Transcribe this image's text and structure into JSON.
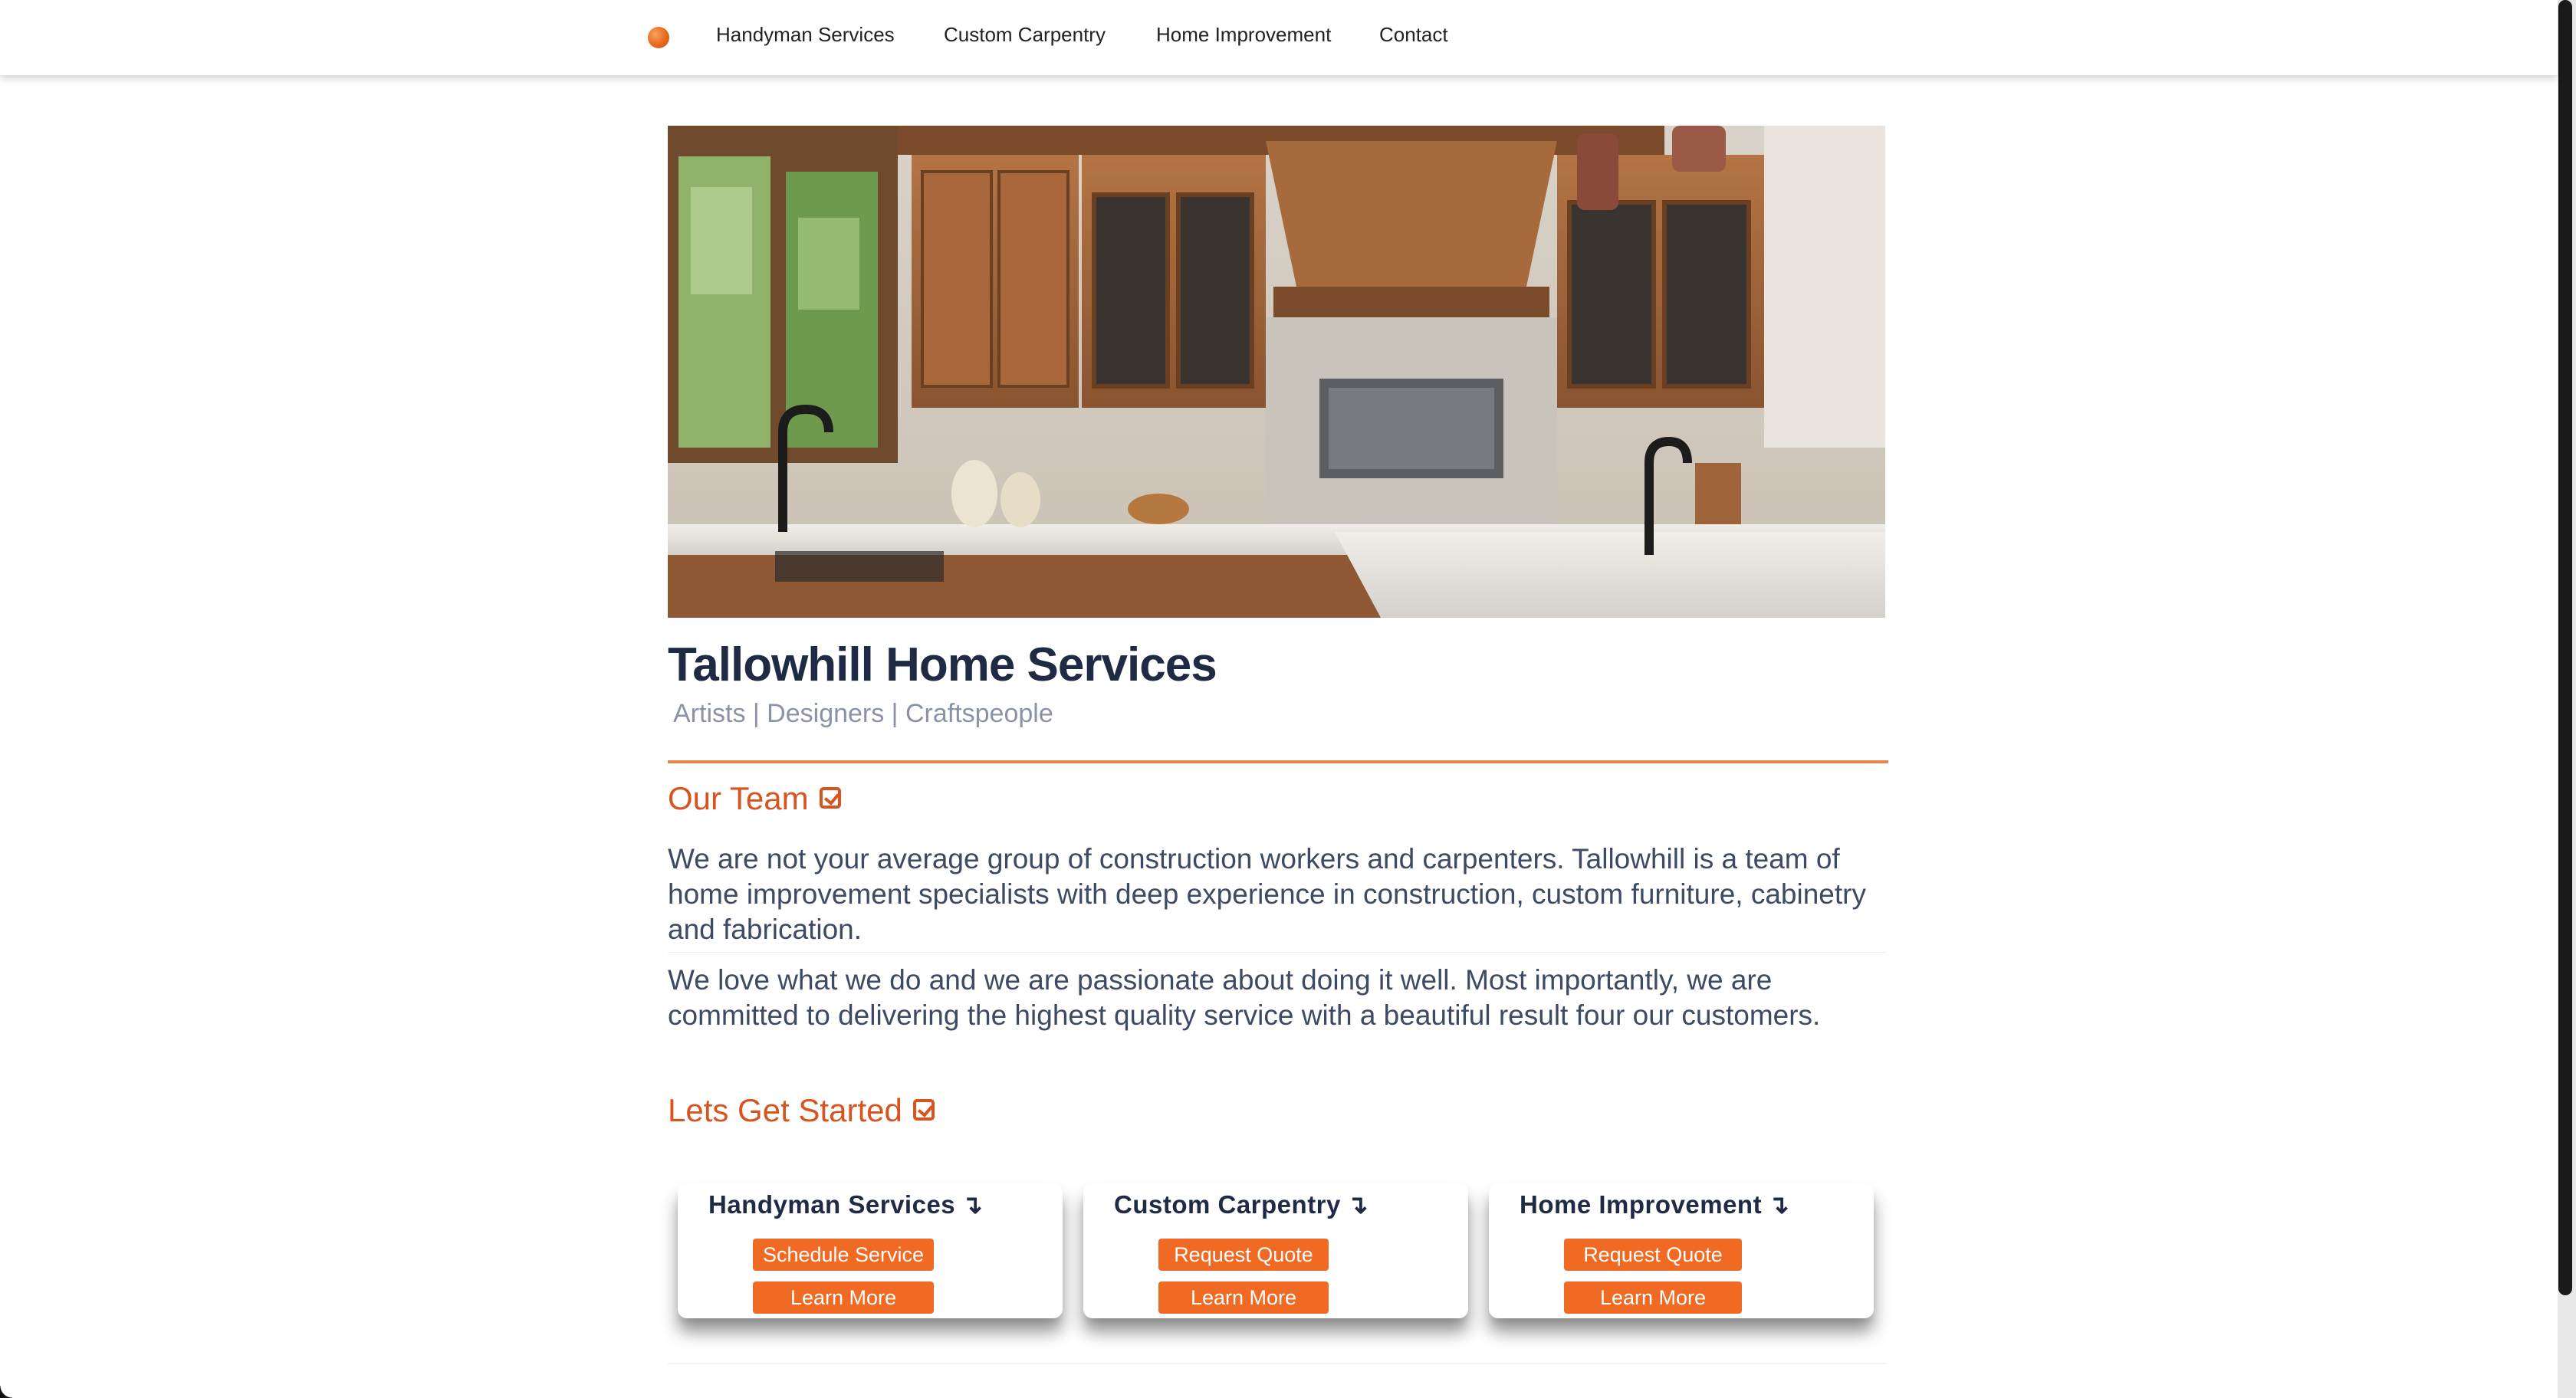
{
  "nav": {
    "items": [
      {
        "label": "Handyman Services"
      },
      {
        "label": "Custom Carpentry"
      },
      {
        "label": "Home Improvement"
      },
      {
        "label": "Contact"
      }
    ]
  },
  "hero": {
    "image": "kitchen-photo"
  },
  "site": {
    "title": "Tallowhill Home Services",
    "tagline": "Artists | Designers | Craftspeople"
  },
  "team": {
    "heading": "Our Team",
    "paragraphs": [
      "We are not your average group of construction workers and carpenters. Tallowhill is a team of home improvement specialists with deep experience in construction, custom furniture, cabinetry and fabrication.",
      "We love what we do and we are passionate about doing it well. Most importantly, we are committed to delivering the highest quality service with a beautiful result four our customers."
    ]
  },
  "start": {
    "heading": "Lets Get Started",
    "cards": [
      {
        "title": "Handyman Services",
        "arrow": "↴",
        "primary": "Schedule Service",
        "secondary": "Learn More"
      },
      {
        "title": "Custom Carpentry",
        "arrow": "↴",
        "primary": "Request Quote",
        "secondary": "Learn More"
      },
      {
        "title": "Home Improvement",
        "arrow": "↴",
        "primary": "Request Quote",
        "secondary": "Learn More"
      }
    ]
  },
  "colors": {
    "accent": "#f06a23",
    "heading": "#d8541f",
    "title": "#1f2a44",
    "body": "#3d4a63"
  }
}
